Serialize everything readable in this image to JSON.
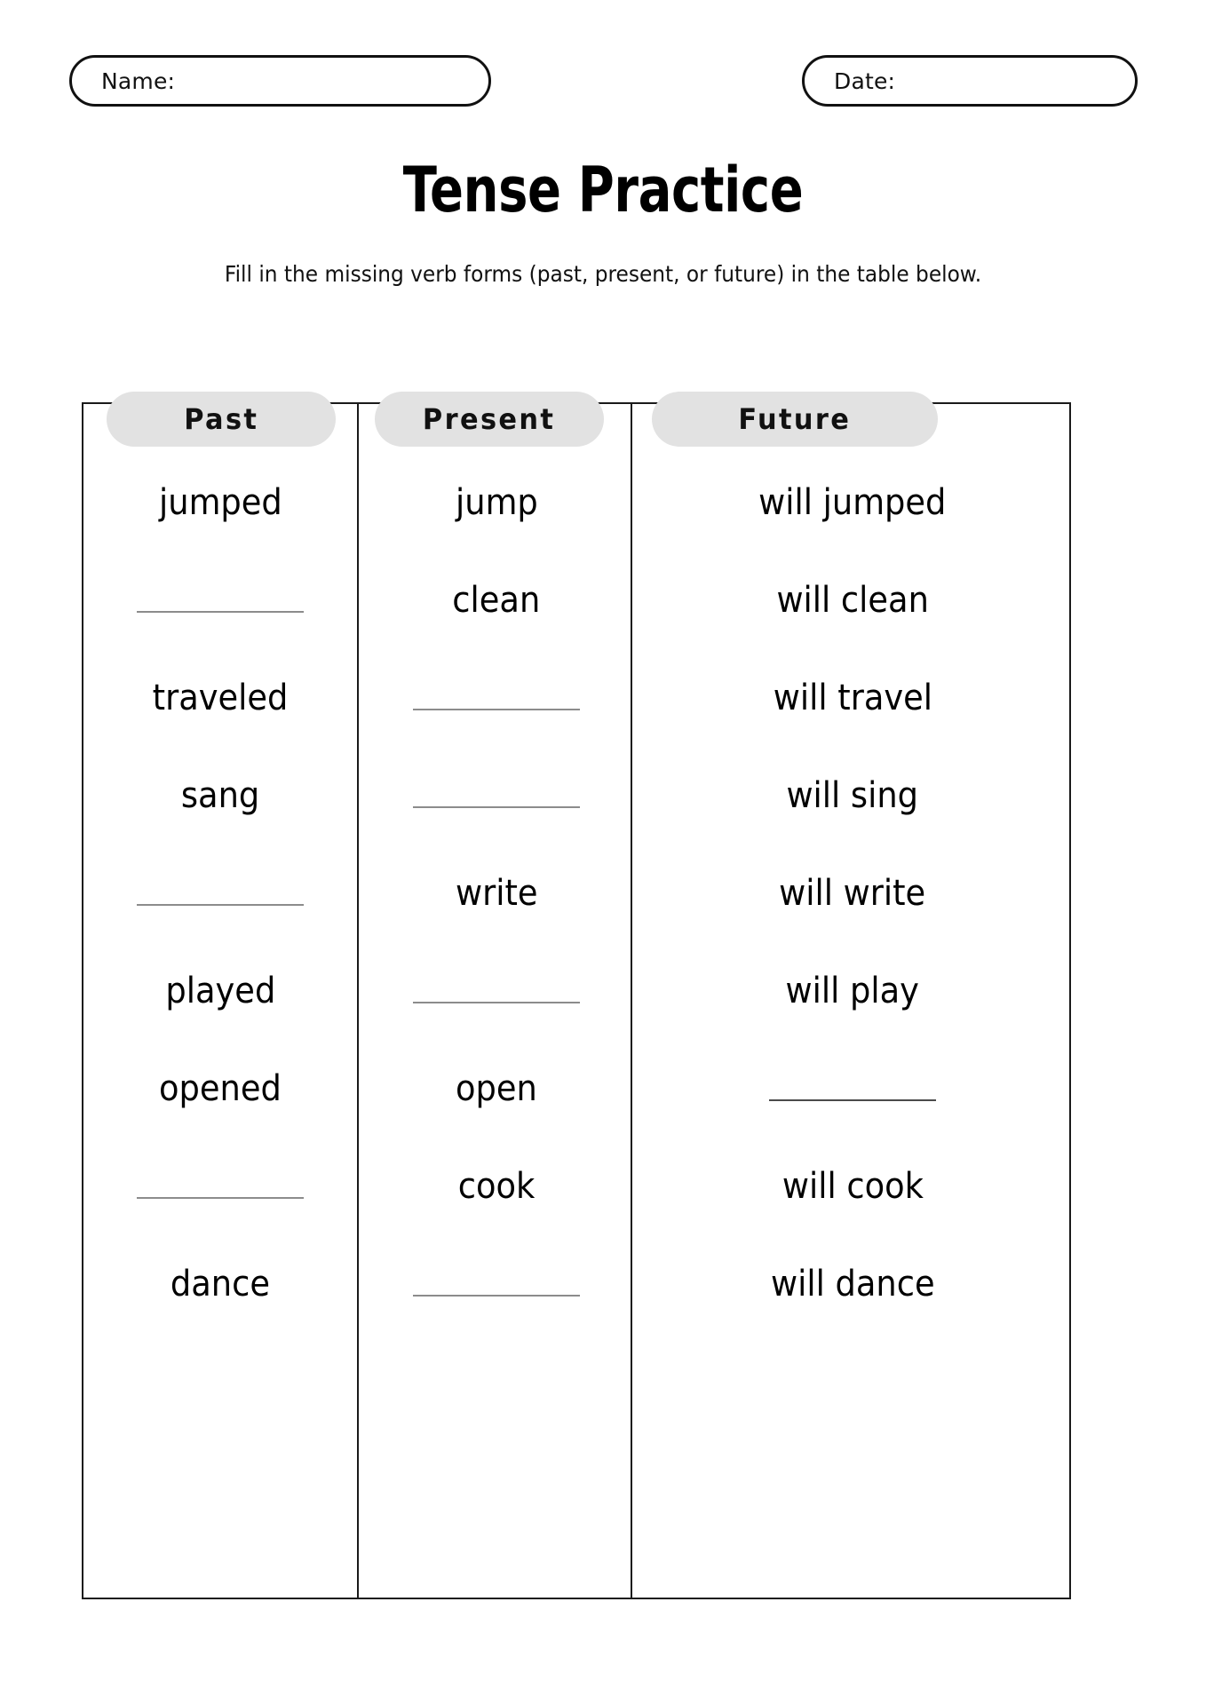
{
  "page": {
    "background_color": "#ffffff",
    "text_color": "#000000"
  },
  "header": {
    "name_label": "Name:",
    "date_label": "Date:",
    "name_value": "",
    "date_value": ""
  },
  "title": "Tense Practice",
  "subtitle": "Fill in the missing verb forms (past, present, or future) in the table below.",
  "table": {
    "pill_color": "#e2e2e2",
    "border_color": "#1a1a1a",
    "blank_line_color": "#8c8c8c",
    "columns": [
      {
        "key": "past",
        "label": "Past"
      },
      {
        "key": "present",
        "label": "Present"
      },
      {
        "key": "future",
        "label": "Future"
      }
    ],
    "rows": [
      {
        "past": "jumped",
        "present": "jump",
        "future": "will jumped"
      },
      {
        "past": "",
        "present": "clean",
        "future": "will clean"
      },
      {
        "past": "traveled",
        "present": "",
        "future": "will travel"
      },
      {
        "past": "sang",
        "present": "",
        "future": "will sing"
      },
      {
        "past": "",
        "present": "write",
        "future": "will write"
      },
      {
        "past": "played",
        "present": "",
        "future": "will play"
      },
      {
        "past": "opened",
        "present": "open",
        "future": ""
      },
      {
        "past": "",
        "present": "cook",
        "future": "will cook"
      },
      {
        "past": "dance",
        "present": "",
        "future": "will dance"
      }
    ]
  }
}
